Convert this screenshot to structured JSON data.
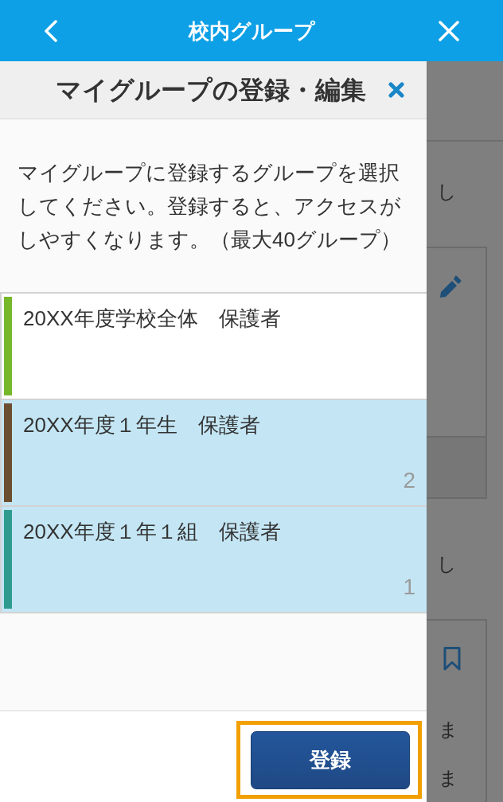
{
  "top_bar": {
    "title": "校内グループ"
  },
  "dialog": {
    "title": "マイグループの登録・編集",
    "description": "マイグループに登録するグループを選択してください。登録すると、アクセスがしやすくなります。（最大40グループ）",
    "groups": [
      {
        "label": "20XX年度学校全体　保護者",
        "color": "#76b82a",
        "selected": false
      },
      {
        "label": "20XX年度１年生　保護者",
        "color": "#6b4e30",
        "selected": true,
        "order": "2"
      },
      {
        "label": "20XX年度１年１組　保護者",
        "color": "#2f9b8f",
        "selected": true,
        "order": "1"
      }
    ],
    "register_button": {
      "label": "登録",
      "highlighted": true
    }
  },
  "background": {
    "blocks": [
      {
        "kind": "text",
        "text": "し"
      },
      {
        "kind": "edit-card"
      },
      {
        "kind": "text",
        "text": "し"
      },
      {
        "kind": "bookmark-card",
        "lines": [
          "ま",
          "ま"
        ]
      }
    ]
  }
}
